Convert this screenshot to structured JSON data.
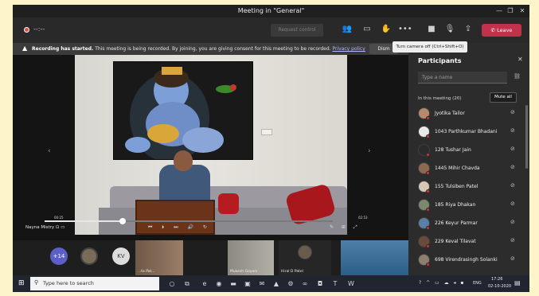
{
  "window": {
    "title": "Meeting in \"General\"",
    "minimize": "—",
    "maximize": "❐",
    "close": "✕"
  },
  "toolbar": {
    "timer": "--:--",
    "request_control": "Request control",
    "leave": "Leave",
    "tooltip": "Turn camera off (Ctrl+Shift+O)",
    "icons": [
      "participants-icon",
      "chat-icon",
      "raise-hand-icon",
      "more-icon",
      "camera-icon",
      "mic-icon",
      "share-icon"
    ]
  },
  "banner": {
    "title": "Recording has started.",
    "message": "This meeting is being recorded. By joining, you are giving consent for this meeting to be recorded.",
    "link": "Privacy policy",
    "dismiss": "Dism"
  },
  "stage": {
    "speaker": "Nayna Mistry",
    "time_left": "00:25",
    "time_right": "02:53",
    "progress": 0.27
  },
  "gallery": {
    "more_count": "+14",
    "kv_initials": "KV",
    "tiles": [
      {
        "name": "...ta Pat..."
      },
      {
        "name": "Mukesh Goyani"
      },
      {
        "name": "Hiral D Patel"
      },
      {
        "name": ""
      }
    ]
  },
  "participants": {
    "title": "Participants",
    "search_placeholder": "Type a name",
    "section": "In this meeting (20)",
    "mute_all": "Mute all",
    "items": [
      {
        "name": "Jyotika Tailor",
        "color": "#b58a6e"
      },
      {
        "name": "1043 Parthkumar Bhadani",
        "color": "#e9e9e9"
      },
      {
        "name": "128 Tushar Jain",
        "color": "#2b2b2b"
      },
      {
        "name": "1445 Mihir Chavda",
        "color": "#8c6a52"
      },
      {
        "name": "155 Tulsiben Patel",
        "color": "#d6c7b6"
      },
      {
        "name": "185 Riya Dhakan",
        "color": "#7a8a6a"
      },
      {
        "name": "226 Keyur Parmar",
        "color": "#5a7fa6"
      },
      {
        "name": "229 Keval Tilavat",
        "color": "#6a4a3a"
      },
      {
        "name": "698 Virendrasingh Solanki",
        "color": "#8e7e6e"
      }
    ]
  },
  "taskbar": {
    "search_placeholder": "Type here to search",
    "lang": "ENG",
    "time": "17:26",
    "date": "02-10-2020"
  }
}
